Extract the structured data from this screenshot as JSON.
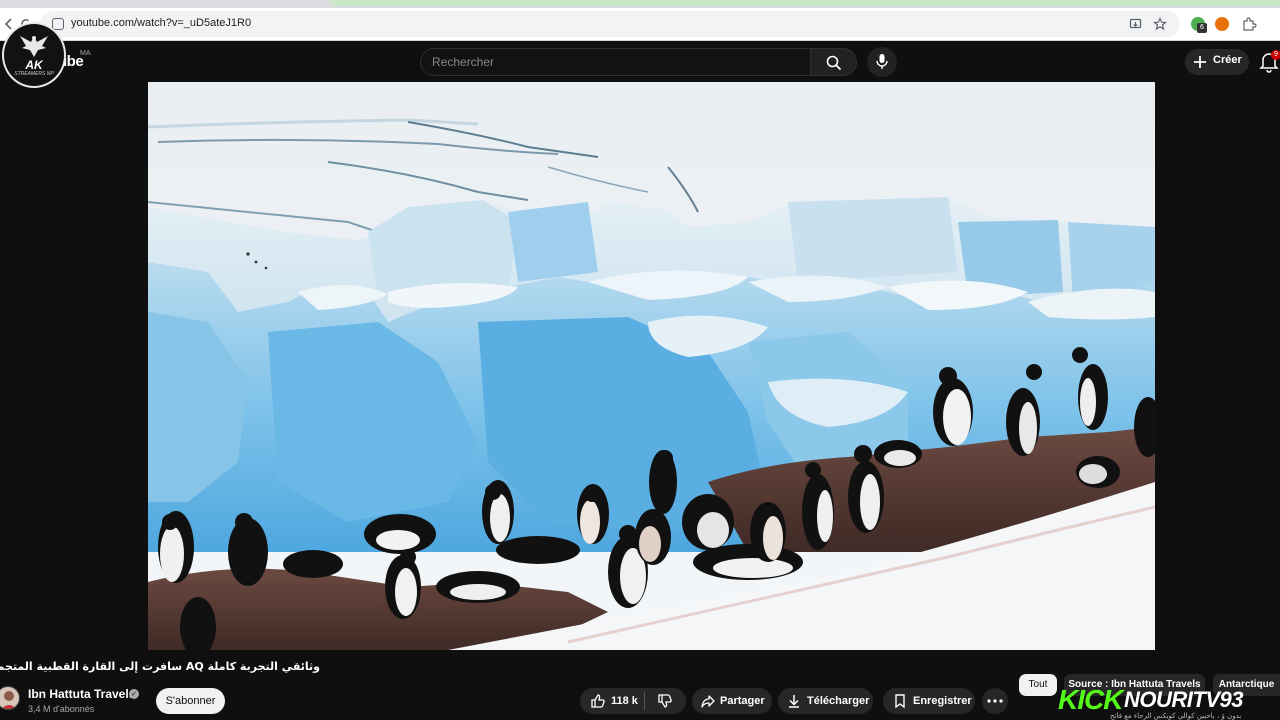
{
  "browser": {
    "url": "youtube.com/watch?v=_uD5ateJ1R0",
    "extension_badge": "6"
  },
  "header": {
    "logo_text": "ube",
    "country_code": "MA",
    "search_placeholder": "Rechercher",
    "create_label": "Créer",
    "notification_count": "9"
  },
  "overlay": {
    "badge_text": "AK",
    "badge_subtext": "STREAMERS NP"
  },
  "video": {
    "title": "وثائقي التجربة كاملة AQ سافرت إلى القارة القطبية المتجمدة أنتاركتيكا",
    "channel_name": "Ibn Hattuta Travels",
    "subscribers": "3,4 M d'abonnés",
    "subscribe_label": "S'abonner"
  },
  "actions": {
    "like_count": "118 k",
    "share_label": "Partager",
    "download_label": "Télécharger",
    "save_label": "Enregistrer"
  },
  "chips": [
    {
      "label": "Tout"
    },
    {
      "label": "Source : Ibn Hattuta Travels"
    },
    {
      "label": "Antarctique"
    }
  ],
  "stream_overlay": {
    "platform": "KICK",
    "channel": "NOURITV93",
    "caption": "بدون ۆ ، باحبين كوالي كويكس الرجاء مع فاتح"
  },
  "colors": {
    "background": "#0f0f0f",
    "kick_green": "#53fc18",
    "notif_red": "#cc0000"
  }
}
